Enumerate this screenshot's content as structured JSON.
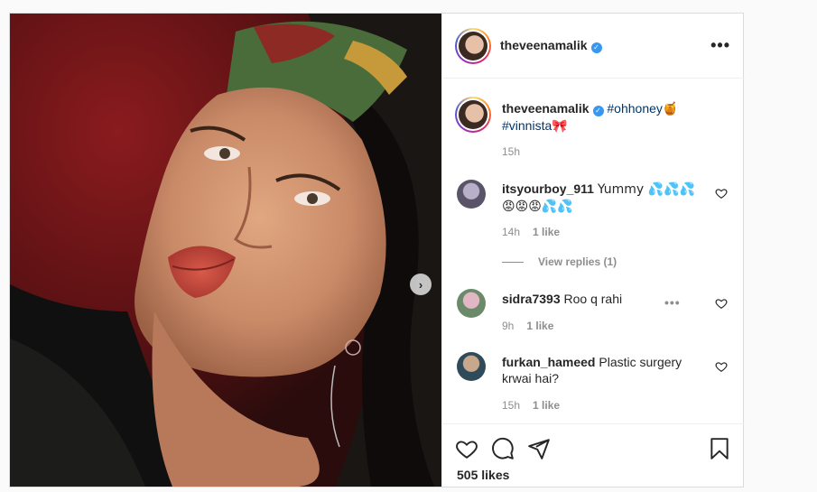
{
  "post": {
    "username": "theveenamalik",
    "verified_icon": "verified-badge-icon",
    "caption_tag_1": "#ohhoney",
    "caption_emoji_1": "🍯",
    "caption_tag_2": "#vinnista",
    "caption_emoji_2": "🎀",
    "caption_time": "15h",
    "likes_label": "505 likes"
  },
  "comments": [
    {
      "username": "itsyourboy_911",
      "text": "Yummy 💦💦💦",
      "text_line2": "😡😡😡💦💦",
      "time": "14h",
      "likes": "1 like",
      "view_replies": "View replies (1)"
    },
    {
      "username": "sidra7393",
      "text": "Roo q rahi",
      "time": "9h",
      "likes": "1 like"
    },
    {
      "username": "furkan_hameed",
      "text": "Plastic surgery",
      "text_line2": "krwai hai?",
      "time": "15h",
      "likes": "1 like"
    }
  ],
  "colors": {
    "accent_link": "#00376b",
    "verified": "#3897f0",
    "muted": "#8e8e8e",
    "text": "#262626"
  },
  "icons": [
    "more-options-icon",
    "next-arrow-icon",
    "heart-icon",
    "comment-icon",
    "share-icon",
    "bookmark-icon"
  ]
}
